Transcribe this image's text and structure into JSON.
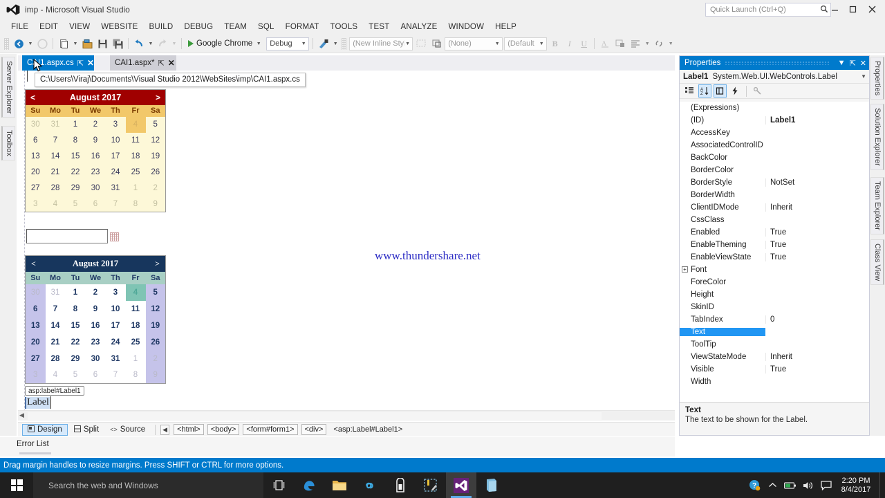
{
  "window": {
    "title": "imp - Microsoft Visual Studio",
    "logo_icon": "visual-studio-icon",
    "minimize_icon": "minimize-icon",
    "maximize_icon": "maximize-icon",
    "close_icon": "close-icon"
  },
  "quick_launch": {
    "placeholder": "Quick Launch (Ctrl+Q)",
    "icon": "search-icon"
  },
  "menu": {
    "items": [
      {
        "label": "FILE"
      },
      {
        "label": "EDIT"
      },
      {
        "label": "VIEW"
      },
      {
        "label": "WEBSITE"
      },
      {
        "label": "BUILD"
      },
      {
        "label": "DEBUG"
      },
      {
        "label": "TEAM"
      },
      {
        "label": "SQL"
      },
      {
        "label": "FORMAT"
      },
      {
        "label": "TOOLS"
      },
      {
        "label": "TEST"
      },
      {
        "label": "ANALYZE"
      },
      {
        "label": "WINDOW"
      },
      {
        "label": "HELP"
      }
    ]
  },
  "toolbar": {
    "navigate_back_icon": "navigate-back-icon",
    "navigate_forward_icon": "navigate-forward-icon",
    "new_item_icon": "new-item-icon",
    "open_icon": "open-file-icon",
    "save_icon": "save-icon",
    "save_all_icon": "save-all-icon",
    "undo_icon": "undo-icon",
    "redo_icon": "redo-icon",
    "start_label": "Google Chrome",
    "start_icon": "play-icon",
    "config_value": "Debug",
    "style_application_icon": "style-application-icon",
    "style_value": "(New Inline Style",
    "target_rule_icon": "target-rule-icon",
    "attach_style_icon": "attach-style-sheet-icon",
    "block_format_value": "(None)",
    "font_family_value": "(Default",
    "bold_label": "B",
    "italic_label": "I",
    "underline_label": "U",
    "foreground_icon": "font-color-icon",
    "background_icon": "background-color-icon",
    "align_icon": "align-left-icon",
    "hyperlink_icon": "hyperlink-icon",
    "overflow_icon": "toolbar-overflow-icon"
  },
  "left_dock": {
    "tabs": [
      "Server Explorer",
      "Toolbox"
    ]
  },
  "right_dock": {
    "tabs": [
      "Properties",
      "Solution Explorer",
      "Team Explorer",
      "Class View"
    ]
  },
  "document_tabs": [
    {
      "label": "CAI1.aspx.cs",
      "active": true,
      "pin_icon": "pin-icon",
      "close_icon": "close-icon"
    },
    {
      "label": "CAI1.aspx*",
      "active": false,
      "pin_icon": "pin-icon",
      "close_icon": "close-icon"
    }
  ],
  "tooltip": {
    "text": "C:\\Users\\Viraj\\Documents\\Visual Studio 2012\\WebSites\\imp\\CAI1.aspx.cs"
  },
  "designer": {
    "watermark": "www.thundershare.net",
    "textbox_value": "",
    "label_tag": "asp:label#Label1",
    "label_text": "Label",
    "calendar_red": {
      "prev_label": "<",
      "next_label": ">",
      "title": "August 2017",
      "day_headers": [
        "Su",
        "Mo",
        "Tu",
        "We",
        "Th",
        "Fr",
        "Sa"
      ],
      "weeks": [
        [
          {
            "d": "30",
            "t": "other"
          },
          {
            "d": "31",
            "t": "other"
          },
          {
            "d": "1",
            "t": "day"
          },
          {
            "d": "2",
            "t": "day"
          },
          {
            "d": "3",
            "t": "day"
          },
          {
            "d": "4",
            "t": "sel"
          },
          {
            "d": "5",
            "t": "day"
          }
        ],
        [
          {
            "d": "6",
            "t": "day"
          },
          {
            "d": "7",
            "t": "day"
          },
          {
            "d": "8",
            "t": "day"
          },
          {
            "d": "9",
            "t": "day"
          },
          {
            "d": "10",
            "t": "day"
          },
          {
            "d": "11",
            "t": "day"
          },
          {
            "d": "12",
            "t": "day"
          }
        ],
        [
          {
            "d": "13",
            "t": "day"
          },
          {
            "d": "14",
            "t": "day"
          },
          {
            "d": "15",
            "t": "day"
          },
          {
            "d": "16",
            "t": "day"
          },
          {
            "d": "17",
            "t": "day"
          },
          {
            "d": "18",
            "t": "day"
          },
          {
            "d": "19",
            "t": "day"
          }
        ],
        [
          {
            "d": "20",
            "t": "day"
          },
          {
            "d": "21",
            "t": "day"
          },
          {
            "d": "22",
            "t": "day"
          },
          {
            "d": "23",
            "t": "day"
          },
          {
            "d": "24",
            "t": "day"
          },
          {
            "d": "25",
            "t": "day"
          },
          {
            "d": "26",
            "t": "day"
          }
        ],
        [
          {
            "d": "27",
            "t": "day"
          },
          {
            "d": "28",
            "t": "day"
          },
          {
            "d": "29",
            "t": "day"
          },
          {
            "d": "30",
            "t": "day"
          },
          {
            "d": "31",
            "t": "day"
          },
          {
            "d": "1",
            "t": "other"
          },
          {
            "d": "2",
            "t": "other"
          }
        ],
        [
          {
            "d": "3",
            "t": "other"
          },
          {
            "d": "4",
            "t": "other"
          },
          {
            "d": "5",
            "t": "other"
          },
          {
            "d": "6",
            "t": "other"
          },
          {
            "d": "7",
            "t": "other"
          },
          {
            "d": "8",
            "t": "other"
          },
          {
            "d": "9",
            "t": "other"
          }
        ]
      ]
    },
    "calendar_blue": {
      "prev_label": "<",
      "next_label": ">",
      "title": "August 2017",
      "day_headers": [
        "Su",
        "Mo",
        "Tu",
        "We",
        "Th",
        "Fr",
        "Sa"
      ],
      "weeks": [
        [
          {
            "d": "30",
            "t": "other wknd"
          },
          {
            "d": "31",
            "t": "other"
          },
          {
            "d": "1",
            "t": "day"
          },
          {
            "d": "2",
            "t": "day"
          },
          {
            "d": "3",
            "t": "day"
          },
          {
            "d": "4",
            "t": "sel"
          },
          {
            "d": "5",
            "t": "day wknd"
          }
        ],
        [
          {
            "d": "6",
            "t": "day wknd"
          },
          {
            "d": "7",
            "t": "day"
          },
          {
            "d": "8",
            "t": "day"
          },
          {
            "d": "9",
            "t": "day"
          },
          {
            "d": "10",
            "t": "day"
          },
          {
            "d": "11",
            "t": "day"
          },
          {
            "d": "12",
            "t": "day wknd"
          }
        ],
        [
          {
            "d": "13",
            "t": "day wknd"
          },
          {
            "d": "14",
            "t": "day"
          },
          {
            "d": "15",
            "t": "day"
          },
          {
            "d": "16",
            "t": "day"
          },
          {
            "d": "17",
            "t": "day"
          },
          {
            "d": "18",
            "t": "day"
          },
          {
            "d": "19",
            "t": "day wknd"
          }
        ],
        [
          {
            "d": "20",
            "t": "day wknd"
          },
          {
            "d": "21",
            "t": "day"
          },
          {
            "d": "22",
            "t": "day"
          },
          {
            "d": "23",
            "t": "day"
          },
          {
            "d": "24",
            "t": "day"
          },
          {
            "d": "25",
            "t": "day"
          },
          {
            "d": "26",
            "t": "day wknd"
          }
        ],
        [
          {
            "d": "27",
            "t": "day wknd"
          },
          {
            "d": "28",
            "t": "day"
          },
          {
            "d": "29",
            "t": "day"
          },
          {
            "d": "30",
            "t": "day"
          },
          {
            "d": "31",
            "t": "day"
          },
          {
            "d": "1",
            "t": "other"
          },
          {
            "d": "2",
            "t": "other wknd"
          }
        ],
        [
          {
            "d": "3",
            "t": "other wknd"
          },
          {
            "d": "4",
            "t": "other"
          },
          {
            "d": "5",
            "t": "other"
          },
          {
            "d": "6",
            "t": "other"
          },
          {
            "d": "7",
            "t": "other"
          },
          {
            "d": "8",
            "t": "other"
          },
          {
            "d": "9",
            "t": "other wknd"
          }
        ]
      ]
    }
  },
  "view_switch": {
    "design_label": "Design",
    "design_icon": "design-view-icon",
    "split_label": "Split",
    "split_icon": "split-view-icon",
    "source_label": "Source",
    "source_icon": "source-view-icon",
    "breadcrumb_back_icon": "breadcrumb-back-icon",
    "breadcrumbs": [
      "<html>",
      "<body>",
      "<form#form1>",
      "<div>",
      "<asp:Label#Label1>"
    ]
  },
  "properties": {
    "panel_title": "Properties",
    "dropdown_icon": "chevron-down-icon",
    "pin_icon": "pin-icon",
    "close_icon": "close-icon",
    "object_name": "Label1",
    "object_type": "System.Web.UI.WebControls.Label",
    "object_dropdown_icon": "chevron-down-icon",
    "tools": [
      {
        "name": "categorized-icon",
        "glyph": "☷",
        "on": false
      },
      {
        "name": "alphabetical-sort-icon",
        "glyph": "↓",
        "on": true
      },
      {
        "name": "properties-view-icon",
        "glyph": "❐",
        "on": true
      },
      {
        "name": "events-view-icon",
        "glyph": "⚡",
        "on": false
      },
      {
        "name": "property-pages-icon",
        "glyph": "🔧",
        "on": false
      }
    ],
    "rows": [
      {
        "name": "(Expressions)",
        "value": "",
        "expander": false,
        "bold": false,
        "selected": false
      },
      {
        "name": "(ID)",
        "value": "Label1",
        "expander": false,
        "bold": true,
        "selected": false
      },
      {
        "name": "AccessKey",
        "value": "",
        "expander": false,
        "bold": false,
        "selected": false
      },
      {
        "name": "AssociatedControlID",
        "value": "",
        "expander": false,
        "bold": false,
        "selected": false
      },
      {
        "name": "BackColor",
        "value": "",
        "expander": false,
        "bold": false,
        "selected": false
      },
      {
        "name": "BorderColor",
        "value": "",
        "expander": false,
        "bold": false,
        "selected": false
      },
      {
        "name": "BorderStyle",
        "value": "NotSet",
        "expander": false,
        "bold": false,
        "selected": false
      },
      {
        "name": "BorderWidth",
        "value": "",
        "expander": false,
        "bold": false,
        "selected": false
      },
      {
        "name": "ClientIDMode",
        "value": "Inherit",
        "expander": false,
        "bold": false,
        "selected": false
      },
      {
        "name": "CssClass",
        "value": "",
        "expander": false,
        "bold": false,
        "selected": false
      },
      {
        "name": "Enabled",
        "value": "True",
        "expander": false,
        "bold": false,
        "selected": false
      },
      {
        "name": "EnableTheming",
        "value": "True",
        "expander": false,
        "bold": false,
        "selected": false
      },
      {
        "name": "EnableViewState",
        "value": "True",
        "expander": false,
        "bold": false,
        "selected": false
      },
      {
        "name": "Font",
        "value": "",
        "expander": true,
        "bold": false,
        "selected": false
      },
      {
        "name": "ForeColor",
        "value": "",
        "expander": false,
        "bold": false,
        "selected": false
      },
      {
        "name": "Height",
        "value": "",
        "expander": false,
        "bold": false,
        "selected": false
      },
      {
        "name": "SkinID",
        "value": "",
        "expander": false,
        "bold": false,
        "selected": false
      },
      {
        "name": "TabIndex",
        "value": "0",
        "expander": false,
        "bold": false,
        "selected": false
      },
      {
        "name": "Text",
        "value": "",
        "expander": false,
        "bold": false,
        "selected": true
      },
      {
        "name": "ToolTip",
        "value": "",
        "expander": false,
        "bold": false,
        "selected": false
      },
      {
        "name": "ViewStateMode",
        "value": "Inherit",
        "expander": false,
        "bold": false,
        "selected": false
      },
      {
        "name": "Visible",
        "value": "True",
        "expander": false,
        "bold": false,
        "selected": false
      },
      {
        "name": "Width",
        "value": "",
        "expander": false,
        "bold": false,
        "selected": false
      }
    ],
    "description_title": "Text",
    "description_body": "The text to be shown for the Label."
  },
  "error_list": {
    "tab_label": "Error List"
  },
  "status_bar": {
    "message": "Drag margin handles to resize margins. Press SHIFT or CTRL for more options."
  },
  "taskbar": {
    "start_icon": "windows-start-icon",
    "search_placeholder": "Search the web and Windows",
    "buttons": [
      {
        "name": "task-view-icon",
        "glyph": "▢",
        "active": false
      },
      {
        "name": "edge-browser-icon",
        "glyph": "e",
        "active": false
      },
      {
        "name": "file-explorer-icon",
        "glyph": "🗀",
        "active": false
      },
      {
        "name": "infinity-app-icon",
        "glyph": "∞",
        "active": false
      },
      {
        "name": "microsoft-store-icon",
        "glyph": "🛍",
        "active": false
      },
      {
        "name": "snipping-tool-icon",
        "glyph": "✂",
        "active": false
      },
      {
        "name": "visual-studio-icon",
        "glyph": "⯈",
        "active": true
      },
      {
        "name": "windows-explorer-book-icon",
        "glyph": "📘",
        "active": false
      }
    ],
    "tray": [
      {
        "name": "get-windows-10-icon",
        "glyph": "?"
      },
      {
        "name": "show-hidden-icons-icon",
        "glyph": "∧"
      },
      {
        "name": "battery-icon",
        "glyph": "🔋"
      },
      {
        "name": "volume-icon",
        "glyph": "🔊"
      },
      {
        "name": "action-center-icon",
        "glyph": "🗪"
      }
    ],
    "clock_time": "2:20 PM",
    "clock_date": "8/4/2017"
  }
}
